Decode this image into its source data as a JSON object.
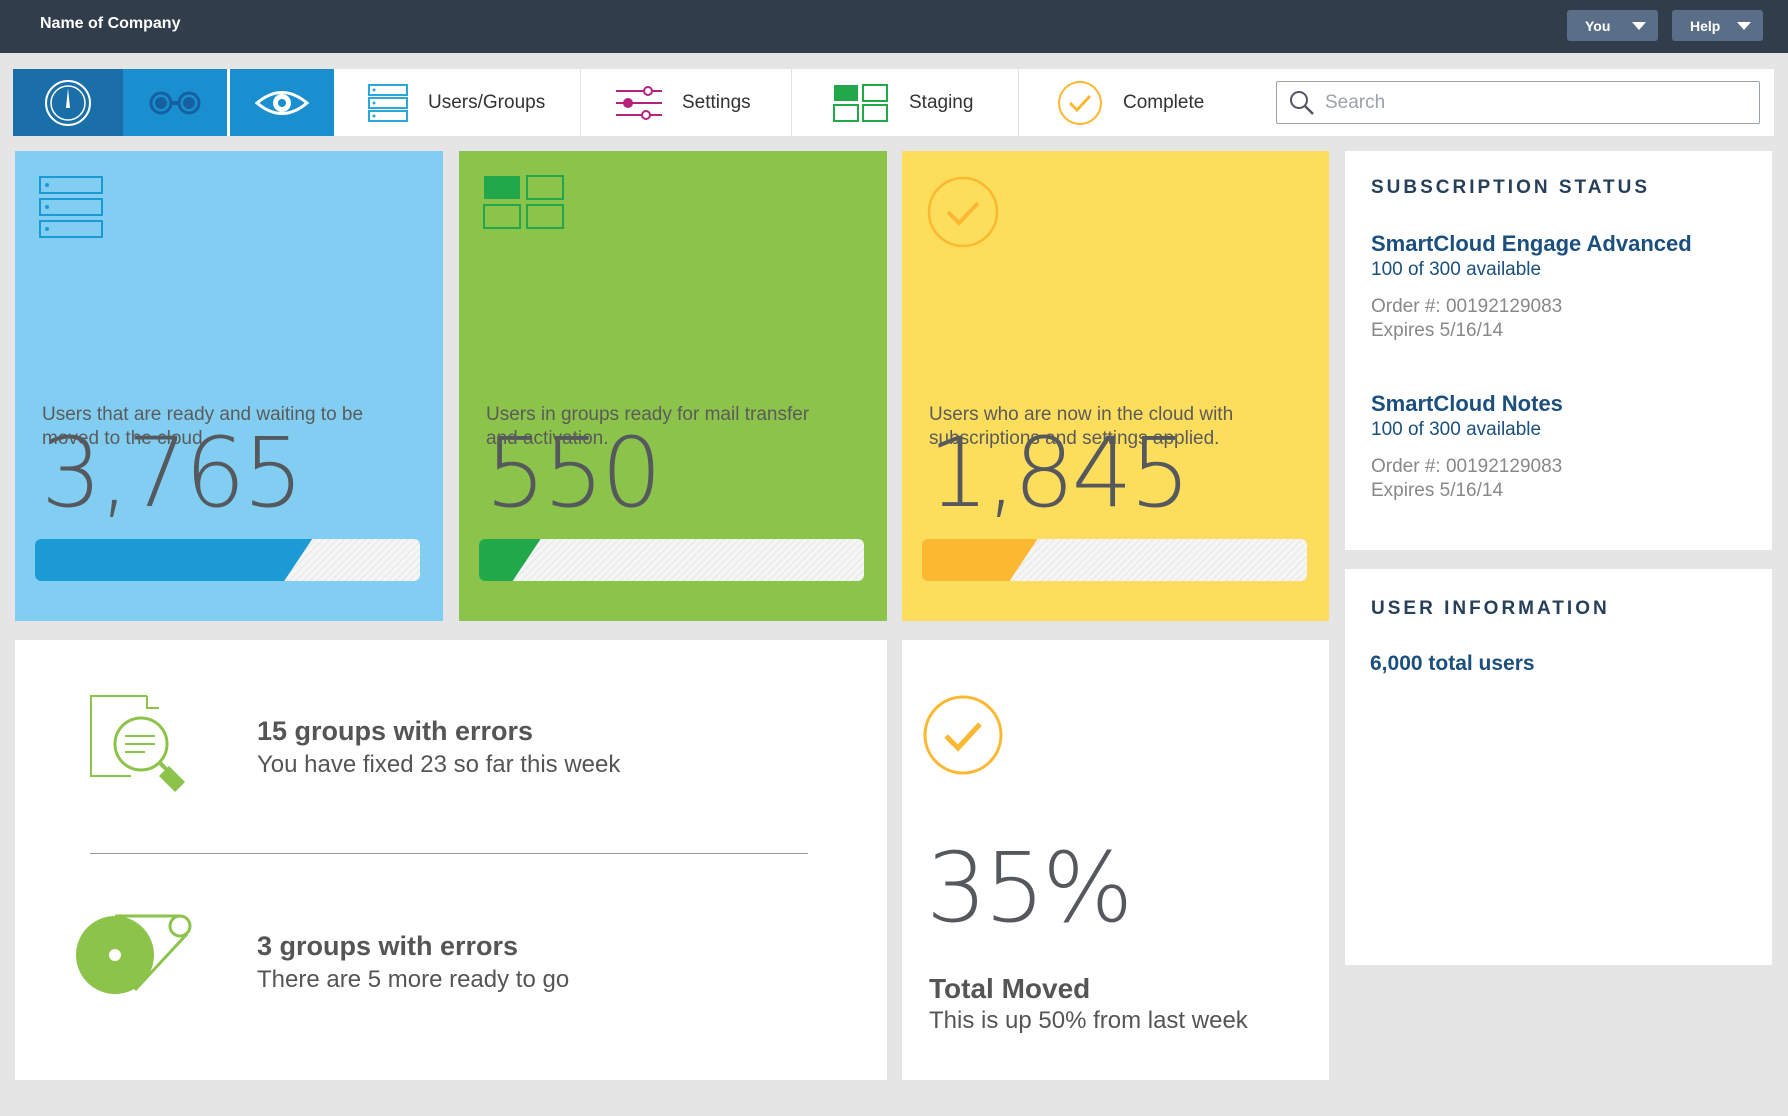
{
  "header": {
    "company": "Name of Company",
    "you_label": "You",
    "help_label": "Help"
  },
  "nav": {
    "items": [
      {
        "label": "Users/Groups",
        "icon": "server-list-icon"
      },
      {
        "label": "Settings",
        "icon": "sliders-icon"
      },
      {
        "label": "Staging",
        "icon": "grid-icon"
      },
      {
        "label": "Complete",
        "icon": "checkmark-circle-icon"
      }
    ],
    "search_placeholder": "Search"
  },
  "cards": {
    "ready": {
      "number": "3,765",
      "desc": "Users that are ready and waiting to be moved to the cloud",
      "progress": 0.68,
      "color": "#1b9ad6"
    },
    "groups": {
      "number": "550",
      "desc": "Users in groups ready for mail transfer and activation.",
      "progress": 0.12,
      "color": "#20a84a"
    },
    "cloud": {
      "number": "1,845",
      "desc": "Users who are now in the cloud with subscriptions and settings applied.",
      "progress": 0.26,
      "color": "#fbb830"
    }
  },
  "errors": {
    "row1": {
      "title": "15 groups with errors",
      "sub": "You have fixed 23 so far this week"
    },
    "row2": {
      "title": "3 groups with errors",
      "sub": "There are 5 more ready to go"
    }
  },
  "moved": {
    "pct": "35%",
    "title": "Total Moved",
    "sub": "This is up 50% from last week"
  },
  "subscription": {
    "title": "SUBSCRIPTION STATUS",
    "products": [
      {
        "name": "SmartCloud Engage Advanced",
        "available": "100 of 300 available",
        "order": "Order #: 00192129083",
        "expires": "Expires 5/16/14"
      },
      {
        "name": "SmartCloud Notes",
        "available": "100 of 300 available",
        "order": "Order #: 00192129083",
        "expires": "Expires 5/16/14"
      }
    ]
  },
  "user_info": {
    "title": "USER INFORMATION",
    "total": "6,000 total users"
  }
}
